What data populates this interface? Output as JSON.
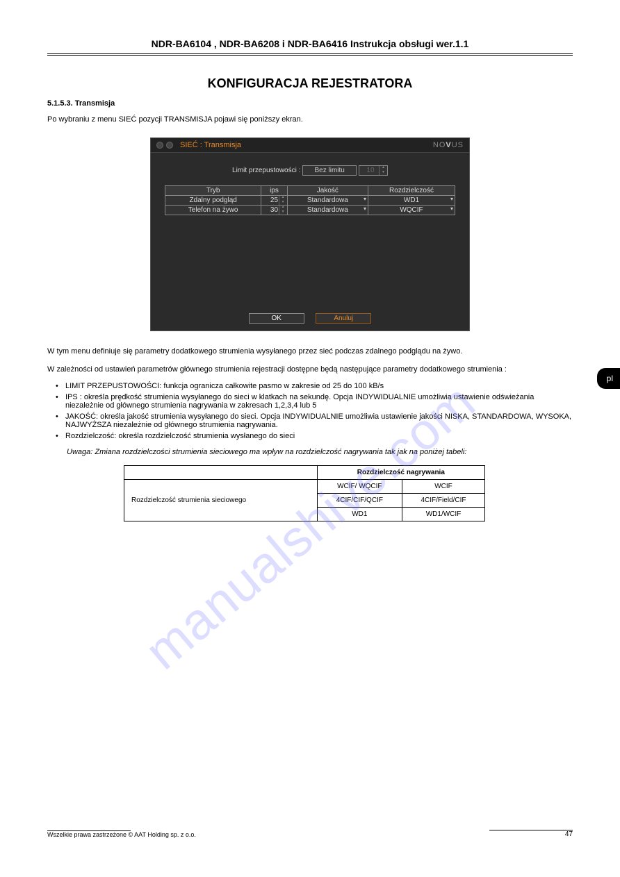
{
  "header": {
    "title": "NDR-BA6104 , NDR-BA6208 i NDR-BA6416 Instrukcja obsługi wer.1.1",
    "subtitle": "",
    "section": "KONFIGURACJA REJESTRATORA"
  },
  "intro": {
    "sub": "5.1.5.3. Transmisja",
    "text": "Po wybraniu z menu SIEĆ pozycji TRANSMISJA pojawi się poniższy ekran."
  },
  "dialog": {
    "title": "SIEĆ : Transmisja",
    "brand_prefix": "NO",
    "brand_bold": "V",
    "brand_suffix": "US",
    "limit_label": "Limit przepustowości :",
    "limit_value": "Bez limitu",
    "limit_spin": "10",
    "headers": {
      "mode": "Tryb",
      "ips": "ips",
      "quality": "Jakość",
      "res": "Rozdzielczość"
    },
    "rows": [
      {
        "mode": "Zdalny podgląd",
        "ips": "25",
        "quality": "Standardowa",
        "res": "WD1"
      },
      {
        "mode": "Telefon na żywo",
        "ips": "30",
        "quality": "Standardowa",
        "res": "WQCIF"
      }
    ],
    "ok": "OK",
    "cancel": "Anuluj"
  },
  "tab": {
    "label": "pl"
  },
  "body": {
    "p1": "W tym menu definiuje się parametry dodatkowego strumienia wysyłanego przez sieć podczas zdalnego podglądu na żywo.",
    "p2": "W zależności od ustawień parametrów głównego strumienia rejestracji dostępne będą następujące parametry dodatkowego strumienia :",
    "bullets": [
      "LIMIT PRZEPUSTOWOŚCI: funkcja ogranicza całkowite pasmo w zakresie od 25 do 100 kB/s",
      "IPS : określa prędkość strumienia wysyłanego do sieci w klatkach na sekundę. Opcja INDYWIDUALNIE umożliwia ustawienie odświeżania niezależnie od głównego strumienia nagrywania w zakresach 1,2,3,4 lub 5",
      "JAKOŚĆ: określa jakość strumienia wysyłanego do sieci. Opcja INDYWIDUALNIE umożliwia ustawienie jakości NISKA, STANDARDOWA, WYSOKA, NAJWYŻSZA niezależnie od głównego strumienia nagrywania.",
      "Rozdzielczość: określa rozdzielczość strumienia wysłanego do sieci"
    ],
    "note_label": "Uwaga:",
    "note": "Zmiana rozdzielczości strumienia sieciowego ma wpływ na rozdzielczość nagrywania tak jak na poniżej tabeli:"
  },
  "res_table": {
    "top": {
      "blank": "",
      "col": "Rozdzielczość nagrywania"
    },
    "rowhead": "Rozdzielczość strumienia sieciowego",
    "rows": [
      {
        "a": "WCIF/ WQCIF",
        "b": "WCIF"
      },
      {
        "a": "4CIF/CIF/QCIF",
        "b": "4CIF/Field/CIF"
      },
      {
        "a": "WD1",
        "b": "WD1/WCIF"
      }
    ]
  },
  "footer": {
    "rights": "Wszelkie prawa zastrzeżone © AAT Holding sp. z o.o.",
    "page": "47"
  },
  "watermark": "manualshive.com"
}
